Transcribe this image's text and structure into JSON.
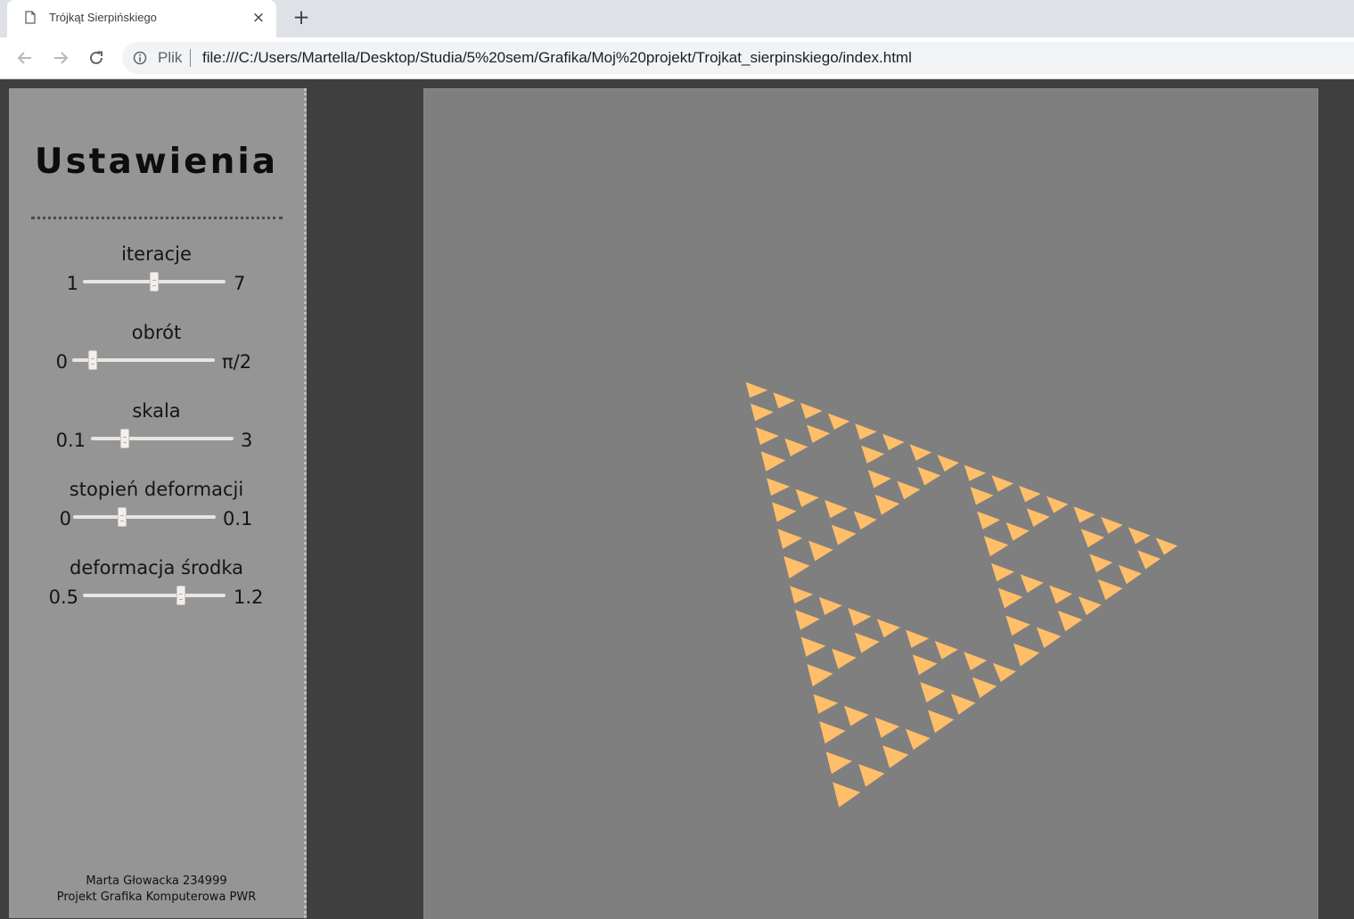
{
  "browser": {
    "tab_title": "Trójkąt Sierpińskiego",
    "close_icon": "×",
    "new_tab_icon": "+",
    "scheme_label": "Plik",
    "url": "file:///C:/Users/Martella/Desktop/Studia/5%20sem/Grafika/Moj%20projekt/Trojkat_sierpinskiego/index.html"
  },
  "settings": {
    "title": "Ustawienia",
    "controls": [
      {
        "label": "iteracje",
        "min": "1",
        "max": "7",
        "value_fraction": 0.5
      },
      {
        "label": "obrót",
        "min": "0",
        "max": "π/2",
        "value_fraction": 0.12
      },
      {
        "label": "skala",
        "min": "0.1",
        "max": "3",
        "value_fraction": 0.22
      },
      {
        "label": "stopień deformacji",
        "min": "0",
        "max": "0.1",
        "value_fraction": 0.33
      },
      {
        "label": "deformacja środka",
        "min": "0.5",
        "max": "1.2",
        "value_fraction": 0.7
      }
    ],
    "footer_line1": "Marta Głowacka 234999",
    "footer_line2": "Projekt Grafika Komputerowa PWR"
  },
  "canvas": {
    "background": "#7f7f7f",
    "fill_color": "#ffbe69",
    "iterations": 4
  }
}
